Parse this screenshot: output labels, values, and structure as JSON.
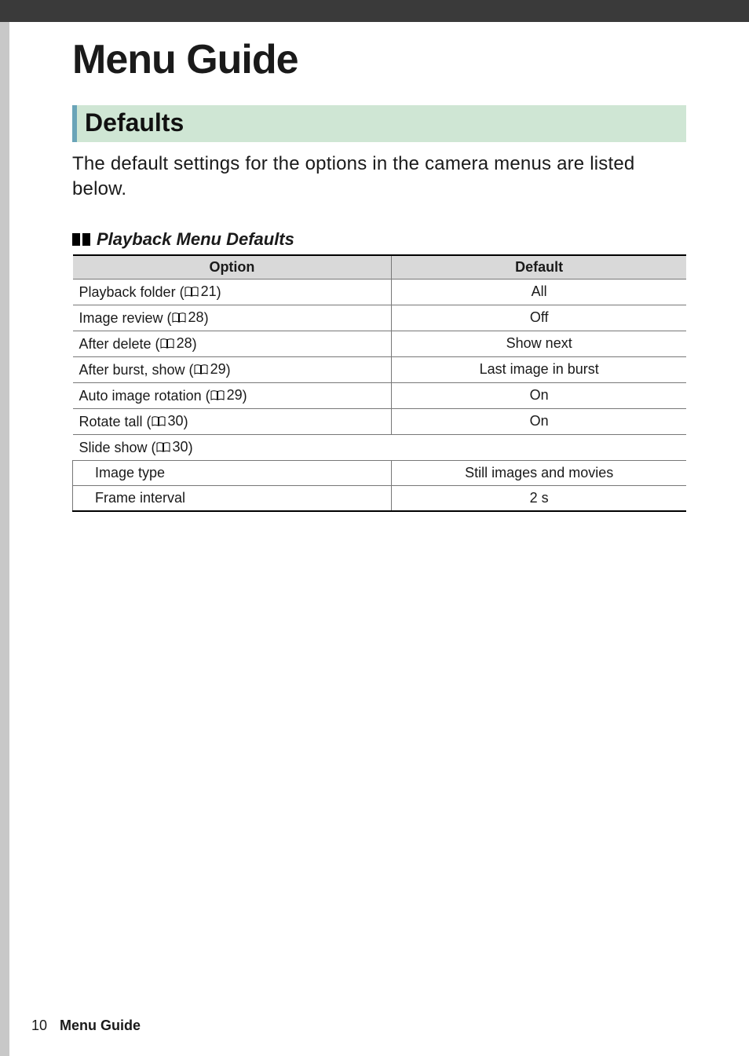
{
  "chapter_title": "Menu Guide",
  "section_title": "Defaults",
  "intro_text": "The default settings for the options in the camera menus are listed below.",
  "sub_title": "Playback Menu Defaults",
  "table": {
    "headers": {
      "option": "Option",
      "default": "Default"
    },
    "rows": [
      {
        "option": "Playback folder",
        "page": "21",
        "default": "All"
      },
      {
        "option": "Image review",
        "page": "28",
        "default": "Off"
      },
      {
        "option": "After delete",
        "page": "28",
        "default": "Show next"
      },
      {
        "option": "After burst, show",
        "page": "29",
        "default": "Last image in burst"
      },
      {
        "option": "Auto image rotation",
        "page": "29",
        "default": "On"
      },
      {
        "option": "Rotate tall",
        "page": "30",
        "default": "On"
      }
    ],
    "group": {
      "label": "Slide show",
      "page": "30",
      "children": [
        {
          "option": "Image type",
          "default": "Still images and movies"
        },
        {
          "option": "Frame interval",
          "default": "2 s"
        }
      ]
    }
  },
  "footer": {
    "page_number": "10",
    "chapter": "Menu Guide"
  }
}
